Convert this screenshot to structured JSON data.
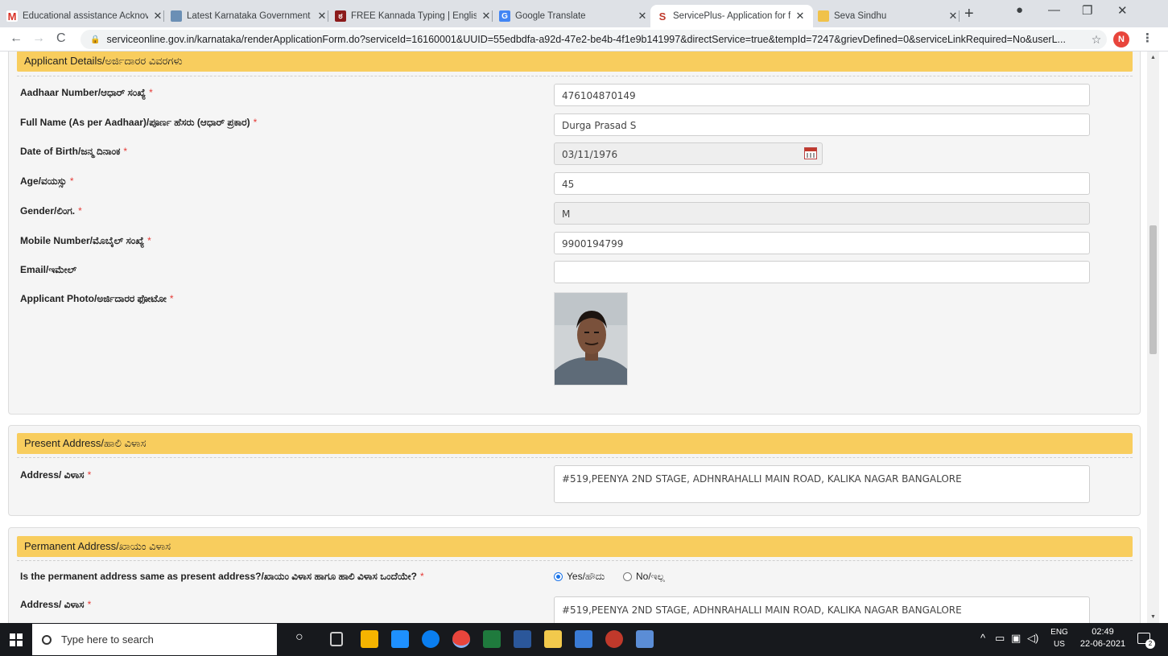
{
  "browser": {
    "tabs": [
      {
        "title": "Educational assistance Acknov",
        "icon": "gmail-icon"
      },
      {
        "title": "Latest Karnataka Government",
        "icon": "karnataka-govt-icon"
      },
      {
        "title": "FREE Kannada Typing | Englist",
        "icon": "kannada-typing-icon"
      },
      {
        "title": "Google Translate",
        "icon": "google-translate-icon"
      },
      {
        "title": "ServicePlus- Application for fi",
        "icon": "serviceplus-icon",
        "active": true
      },
      {
        "title": "Seva Sindhu",
        "icon": "seva-sindhu-icon"
      }
    ],
    "url": "serviceonline.gov.in/karnataka/renderApplicationForm.do?serviceId=16160001&UUID=55edbdfa-a92d-47e2-be4b-4f1e9b141997&directService=true&tempId=7247&grievDefined=0&serviceLinkRequired=No&userL...",
    "profile_initial": "N",
    "accent": "#e8453c"
  },
  "form": {
    "applicant": {
      "header": "Applicant Details/ಅರ್ಜಿದಾರರ ವಿವರಗಳು",
      "aadhaar_label": "Aadhaar Number/ಆಧಾರ್ ಸಂಖ್ಯೆ",
      "aadhaar_value": "476104870149",
      "name_label": "Full Name (As per Aadhaar)/ಪೂರ್ಣ ಹೆಸರು (ಆಧಾರ್ ಪ್ರಕಾರ)",
      "name_value": "Durga Prasad S",
      "dob_label": "Date of Birth/ಜನ್ಮ ದಿನಾಂಕ",
      "dob_value": "03/11/1976",
      "age_label": "Age/ವಯಸ್ಸು",
      "age_value": "45",
      "gender_label": "Gender/ಲಿಂಗ.",
      "gender_value": "M",
      "mobile_label": "Mobile Number/ಮೊಬೈಲ್ ಸಂಖ್ಯೆ",
      "mobile_value": "9900194799",
      "email_label": "Email/ಇಮೇಲ್",
      "email_value": "",
      "photo_label": "Applicant Photo/ಅರ್ಜಿದಾರರ ಫೋಟೋ"
    },
    "present": {
      "header": "Present Address/ಹಾಲಿ ವಿಳಾಸ",
      "address_label": "Address/ ವಿಳಾಸ",
      "address_value": "#519,PEENYA 2ND STAGE, ADHNRAHALLI MAIN ROAD, KALIKA NAGAR BANGALORE"
    },
    "permanent": {
      "header": "Permanent Address/ಖಾಯಂ ವಿಳಾಸ",
      "same_label": "Is the permanent address same as present address?/ಖಾಯಂ ವಿಳಾಸ ಹಾಗೂ ಹಾಲಿ ವಿಳಾಸ ಒಂದೆಯೇ?",
      "yes_label": "Yes/ಹೌದು",
      "no_label": "No/ಇಲ್ಲ",
      "selected": "yes",
      "address_label": "Address/ ವಿಳಾಸ",
      "address_value": "#519,PEENYA 2ND STAGE, ADHNRAHALLI MAIN ROAD, KALIKA NAGAR BANGALORE"
    },
    "required_mark": "*",
    "header_color": "#f8cd5e"
  },
  "taskbar": {
    "search_placeholder": "Type here to search",
    "lang_top": "ENG",
    "lang_bottom": "US",
    "time": "02:49",
    "date": "22-06-2021",
    "notification_count": "2"
  }
}
